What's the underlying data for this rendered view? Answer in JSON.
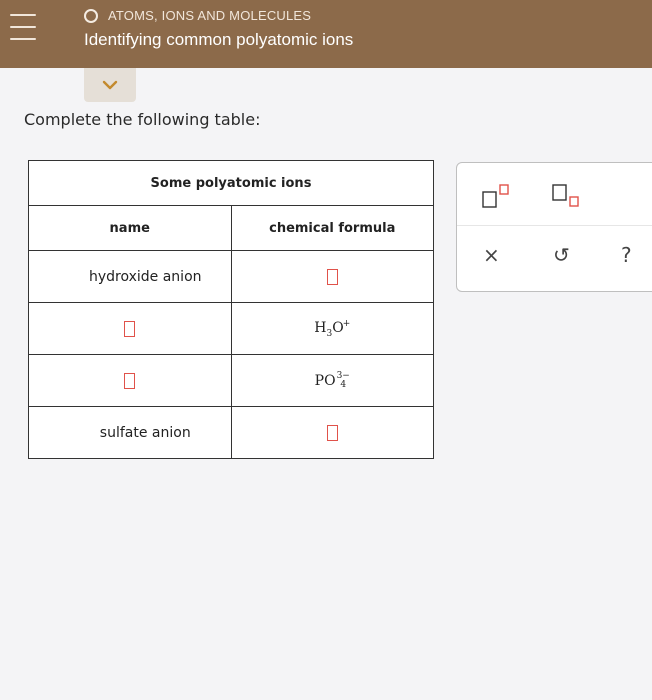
{
  "header": {
    "topic": "ATOMS, IONS AND MOLECULES",
    "title": "Identifying common polyatomic ions"
  },
  "instructions": "Complete the following table:",
  "table": {
    "caption": "Some polyatomic ions",
    "col_name": "name",
    "col_formula": "chemical formula",
    "rows": [
      {
        "name": "hydroxide anion",
        "formula": ""
      },
      {
        "name": "",
        "formula_main": "H",
        "formula_sub": "3",
        "formula_tail": "O",
        "charge": "+"
      },
      {
        "name": "",
        "formula_main": "PO",
        "formula_sub": "4",
        "charge": "3−"
      },
      {
        "name": "sulfate anion",
        "formula": ""
      }
    ]
  },
  "panel": {
    "tools": [
      "superscript-tool",
      "subscript-tool",
      "clear",
      "undo",
      "help"
    ],
    "clear_label": "×",
    "undo_label": "↺",
    "help_label": "?"
  },
  "colors": {
    "header": "#8c6a4a",
    "answer_box": "#e0524a"
  }
}
